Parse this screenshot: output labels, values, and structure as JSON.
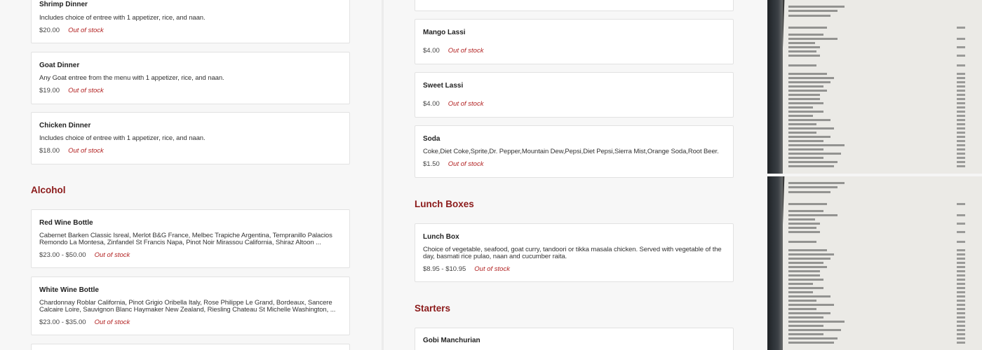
{
  "left_column": {
    "items": [
      {
        "name": "Shrimp Dinner",
        "description": "Includes choice of entree with 1 appetizer, rice, and naan.",
        "price": "$20.00",
        "status": "Out of stock"
      },
      {
        "name": "Goat Dinner",
        "description": "Any Goat entree from the menu with 1 appetizer, rice, and naan.",
        "price": "$19.00",
        "status": "Out of stock"
      },
      {
        "name": "Chicken Dinner",
        "description": "Includes choice of entree with 1 appetizer, rice, and naan.",
        "price": "$18.00",
        "status": "Out of stock"
      }
    ],
    "alcohol_section": {
      "title": "Alcohol",
      "items": [
        {
          "name": "Red Wine Bottle",
          "description": "Cabernet Barken Classic Isreal, Merlot B&G France, Melbec Trapiche Argentina, Tempranillo Palacios Remondo La Montesa, Zinfandel St Francis Napa, Pinot Noir Mirassou California, Shiraz Altoon ...",
          "price": "$23.00 - $50.00",
          "status": "Out of stock"
        },
        {
          "name": "White Wine Bottle",
          "description": "Chardonnay Roblar California, Pinot Grigio Oribella Italy, Rose Philippe Le Grand, Bordeaux, Sancere Calcaire Loire, Sauvignon Blanc Haymaker New Zealand, Riesling Chateau St Michelle Washington, ...",
          "price": "$23.00 - $35.00",
          "status": "Out of stock"
        }
      ]
    }
  },
  "middle_column": {
    "items": [
      {
        "name": "Mango Lassi",
        "price": "$4.00",
        "status": "Out of stock"
      },
      {
        "name": "Sweet Lassi",
        "price": "$4.00",
        "status": "Out of stock"
      },
      {
        "name": "Soda",
        "description": "Coke,Diet Coke,Sprite,Dr. Pepper,Mountain Dew,Pepsi,Diet Pepsi,Sierra Mist,Orange Soda,Root Beer.",
        "price": "$1.50",
        "status": "Out of stock"
      }
    ],
    "lunch_section": {
      "title": "Lunch Boxes",
      "items": [
        {
          "name": "Lunch Box",
          "description": "Choice of vegetable, seafood, goat curry, tandoori or tikka masala chicken. Served with vegetable of the day, basmati rice pulao, naan and cucumber raita.",
          "price": "$8.95 - $10.95",
          "status": "Out of stock"
        }
      ]
    },
    "starters_section": {
      "title": "Starters",
      "items": [
        {
          "name": "Gobi Manchurian"
        }
      ]
    }
  },
  "menu_photos": {
    "count": 2,
    "icon": "menu-photo-image"
  },
  "colors": {
    "accent": "#8b1a1a",
    "out_of_stock": "#b22222",
    "card_border": "#e2e2e2"
  }
}
